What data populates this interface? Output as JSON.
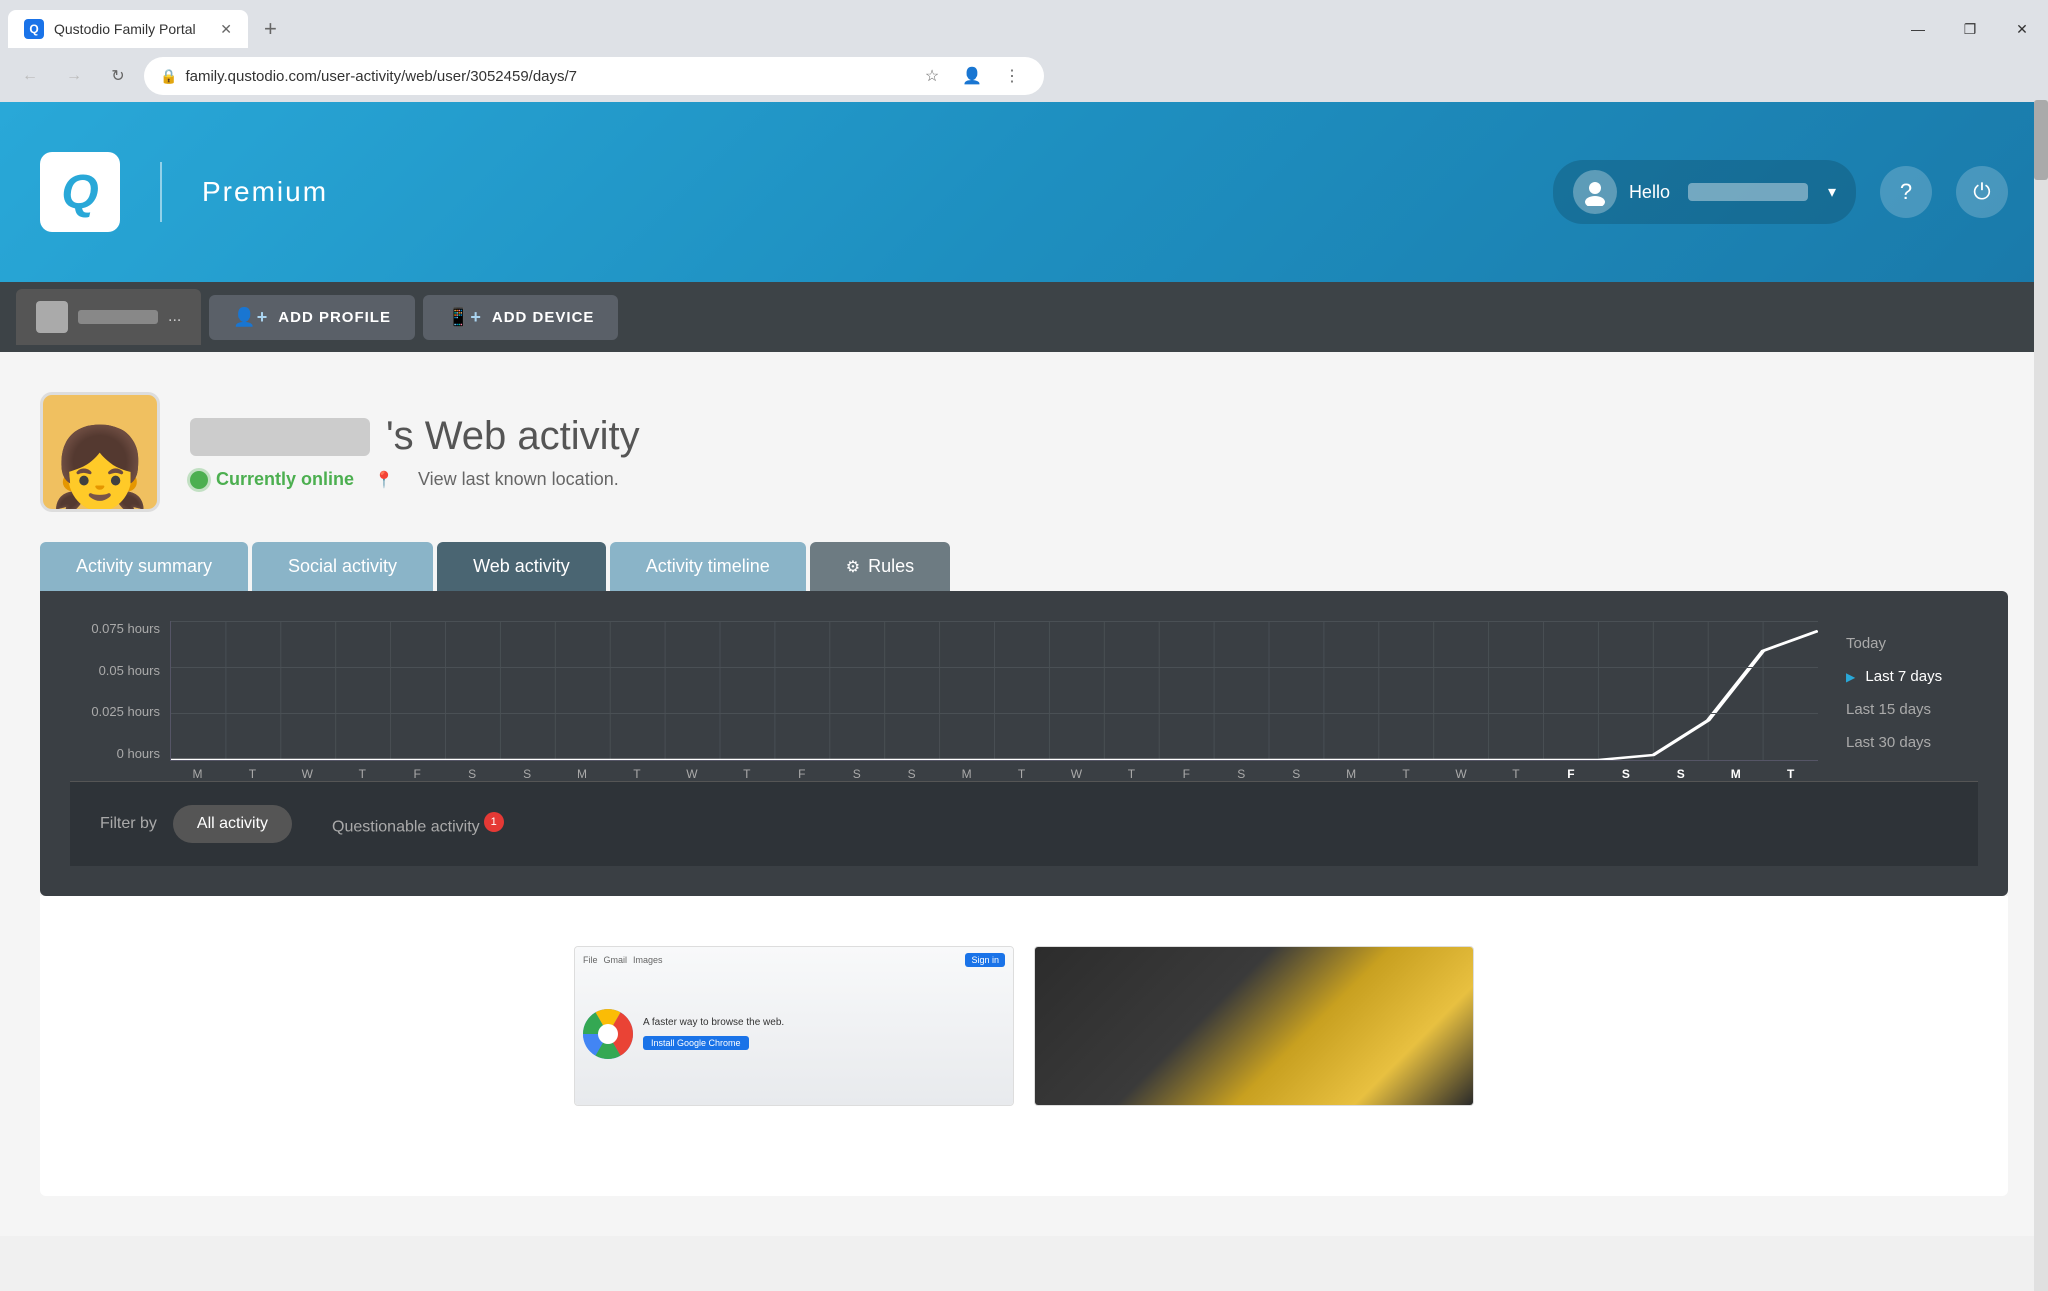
{
  "browser": {
    "tab_title": "Qustodio Family Portal",
    "tab_favicon_letter": "Q",
    "address": "family.qustodio.com/user-activity/web/user/3052459/days/7",
    "new_tab_label": "+",
    "win_minimize": "—",
    "win_restore": "❐",
    "win_close": "✕"
  },
  "header": {
    "logo_letter": "Q",
    "plan_label": "Premium",
    "hello_text": "Hello",
    "question_icon": "?",
    "power_icon": "⏻"
  },
  "profile_bar": {
    "add_profile_label": "ADD PROFILE",
    "add_device_label": "ADD DEVICE",
    "add_profile_icon": "+",
    "add_device_icon": "+"
  },
  "user_section": {
    "name_web_activity": "'s Web activity",
    "currently_online": "Currently online",
    "location_text": "View last known location."
  },
  "tabs": [
    {
      "id": "activity-summary",
      "label": "Activity summary",
      "active": false
    },
    {
      "id": "social-activity",
      "label": "Social activity",
      "active": false
    },
    {
      "id": "web-activity",
      "label": "Web activity",
      "active": true
    },
    {
      "id": "activity-timeline",
      "label": "Activity timeline",
      "active": false
    },
    {
      "id": "rules",
      "label": "Rules",
      "active": false,
      "has_gear": true
    }
  ],
  "chart": {
    "y_labels": [
      "0.075 hours",
      "0.05 hours",
      "0.025 hours",
      "0 hours"
    ],
    "x_labels": [
      "M",
      "T",
      "W",
      "T",
      "F",
      "S",
      "S",
      "M",
      "T",
      "W",
      "T",
      "F",
      "S",
      "S",
      "M",
      "T",
      "W",
      "T",
      "F",
      "S",
      "S",
      "M",
      "T",
      "W",
      "T",
      "F",
      "S",
      "S",
      "M",
      "T"
    ],
    "bold_indices": [
      22,
      23,
      24,
      25,
      26,
      27,
      28,
      29
    ],
    "bold_labels": [
      "W",
      "T",
      "F",
      "S",
      "S",
      "M",
      "T"
    ],
    "legend": [
      {
        "label": "Today",
        "active": false
      },
      {
        "label": "Last 7 days",
        "active": true
      },
      {
        "label": "Last 15 days",
        "active": false
      },
      {
        "label": "Last 30 days",
        "active": false
      }
    ]
  },
  "filter": {
    "label": "Filter by",
    "all_activity": "All activity",
    "questionable_activity": "Questionable activity",
    "badge_count": "1"
  },
  "screenshots": [
    {
      "toolbar_items": [
        "File",
        "Gmail",
        "Images"
      ],
      "sign_in_text": "Sign in",
      "promo_text": "A faster way to browse the web.",
      "btn_text": "Install Google Chrome"
    },
    {
      "dark": true
    }
  ]
}
